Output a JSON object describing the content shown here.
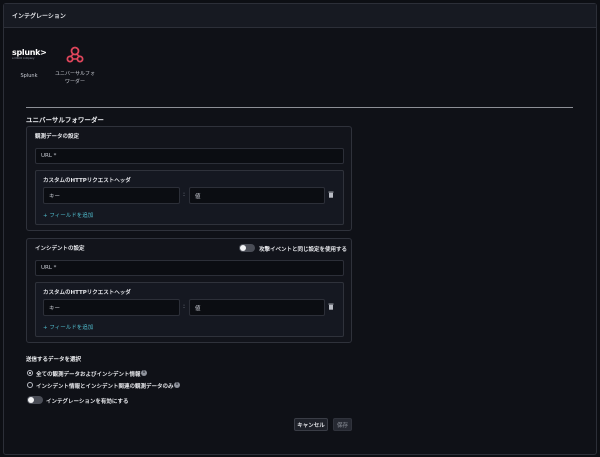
{
  "window": {
    "title": "インテグレーション"
  },
  "integrations": [
    {
      "id": "splunk",
      "logo_word": "splunk>",
      "logo_sub": "a CISCO company",
      "label": "Splunk"
    },
    {
      "id": "universal-forwarder",
      "label": "ユニバーサルフォワーダー"
    }
  ],
  "section": {
    "title": "ユニバーサルフォワーダー"
  },
  "observation": {
    "title": "観測データの設定",
    "url_placeholder": "URL *",
    "headers_title": "カスタムのHTTPリクエストヘッダ",
    "key_placeholder": "キー",
    "value_placeholder": "値",
    "add_field": "+ フィールドを追加"
  },
  "incident": {
    "title": "インシデントの設定",
    "toggle_label": "攻撃イベントと同じ設定を使用する",
    "url_placeholder": "URL *",
    "headers_title": "カスタムのHTTPリクエストヘッダ",
    "key_placeholder": "キー",
    "value_placeholder": "値",
    "add_field": "+ フィールドを追加"
  },
  "data_select": {
    "title": "送信するデータを選択",
    "options": [
      {
        "label": "全ての観測データおよびインシデント情報",
        "selected": true
      },
      {
        "label": "インシデント情報とインシデント関連の観測データのみ",
        "selected": false
      }
    ]
  },
  "enable": {
    "label": "インテグレーションを有効にする",
    "on": false
  },
  "actions": {
    "cancel": "キャンセル",
    "save": "保存"
  },
  "colors": {
    "accent": "#4fb8c9",
    "logo_red": "#e0465c"
  }
}
